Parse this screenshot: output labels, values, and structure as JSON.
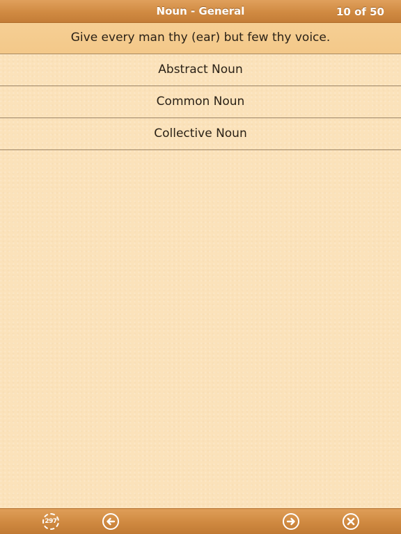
{
  "header": {
    "title": "Noun - General",
    "counter": "10 of 50"
  },
  "question": {
    "text": "Give every man thy (ear) but few thy voice."
  },
  "options": [
    {
      "label": "Abstract Noun"
    },
    {
      "label": "Common Noun"
    },
    {
      "label": "Collective Noun"
    }
  ],
  "footer": {
    "count_badge": "297",
    "icons": [
      "count-badge-icon",
      "arrow-left-icon",
      "arrow-right-icon",
      "close-icon"
    ]
  },
  "colors": {
    "bar": "#d08a42",
    "question_bg": "#f4ca8c",
    "paper": "#fbe2ba",
    "text": "#2a2116"
  }
}
